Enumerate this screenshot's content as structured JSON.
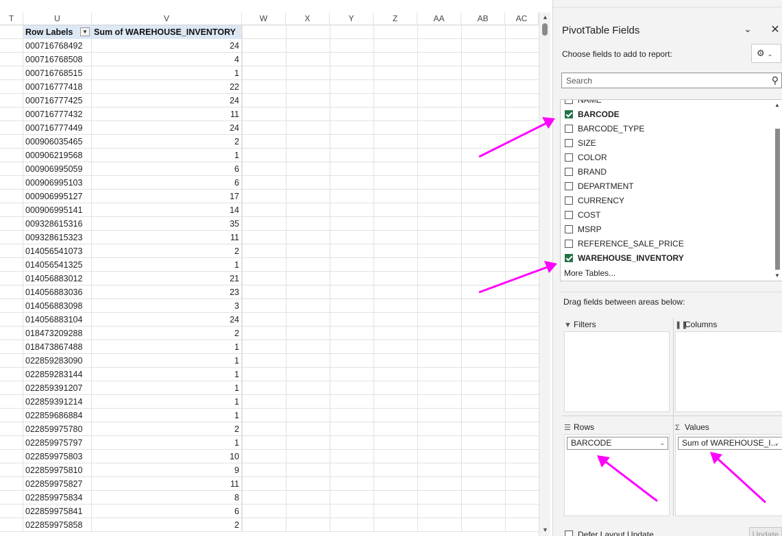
{
  "sheet": {
    "columns": [
      "T",
      "U",
      "V",
      "W",
      "X",
      "Y",
      "Z",
      "AA",
      "AB",
      "AC"
    ],
    "pivot_header": {
      "row_labels": "Row Labels",
      "sum_header": "Sum of WAREHOUSE_INVENTORY"
    },
    "rows": [
      {
        "barcode": "000716768492",
        "qty": "24"
      },
      {
        "barcode": "000716768508",
        "qty": "4"
      },
      {
        "barcode": "000716768515",
        "qty": "1"
      },
      {
        "barcode": "000716777418",
        "qty": "22"
      },
      {
        "barcode": "000716777425",
        "qty": "24"
      },
      {
        "barcode": "000716777432",
        "qty": "11"
      },
      {
        "barcode": "000716777449",
        "qty": "24"
      },
      {
        "barcode": "000906035465",
        "qty": "2"
      },
      {
        "barcode": "000906219568",
        "qty": "1"
      },
      {
        "barcode": "000906995059",
        "qty": "6"
      },
      {
        "barcode": "000906995103",
        "qty": "6"
      },
      {
        "barcode": "000906995127",
        "qty": "17"
      },
      {
        "barcode": "000906995141",
        "qty": "14"
      },
      {
        "barcode": "009328615316",
        "qty": "35"
      },
      {
        "barcode": "009328615323",
        "qty": "11"
      },
      {
        "barcode": "014056541073",
        "qty": "2"
      },
      {
        "barcode": "014056541325",
        "qty": "1"
      },
      {
        "barcode": "014056883012",
        "qty": "21"
      },
      {
        "barcode": "014056883036",
        "qty": "23"
      },
      {
        "barcode": "014056883098",
        "qty": "3"
      },
      {
        "barcode": "014056883104",
        "qty": "24"
      },
      {
        "barcode": "018473209288",
        "qty": "2"
      },
      {
        "barcode": "018473867488",
        "qty": "1"
      },
      {
        "barcode": "022859283090",
        "qty": "1"
      },
      {
        "barcode": "022859283144",
        "qty": "1"
      },
      {
        "barcode": "022859391207",
        "qty": "1"
      },
      {
        "barcode": "022859391214",
        "qty": "1"
      },
      {
        "barcode": "022859686884",
        "qty": "1"
      },
      {
        "barcode": "022859975780",
        "qty": "2"
      },
      {
        "barcode": "022859975797",
        "qty": "1"
      },
      {
        "barcode": "022859975803",
        "qty": "10"
      },
      {
        "barcode": "022859975810",
        "qty": "9"
      },
      {
        "barcode": "022859975827",
        "qty": "11"
      },
      {
        "barcode": "022859975834",
        "qty": "8"
      },
      {
        "barcode": "022859975841",
        "qty": "6"
      },
      {
        "barcode": "022859975858",
        "qty": "2"
      }
    ]
  },
  "pane": {
    "title": "PivotTable Fields",
    "choose_label": "Choose fields to add to report:",
    "search_placeholder": "Search",
    "fields": [
      {
        "name": "NAME",
        "checked": false
      },
      {
        "name": "BARCODE",
        "checked": true
      },
      {
        "name": "BARCODE_TYPE",
        "checked": false
      },
      {
        "name": "SIZE",
        "checked": false
      },
      {
        "name": "COLOR",
        "checked": false
      },
      {
        "name": "BRAND",
        "checked": false
      },
      {
        "name": "DEPARTMENT",
        "checked": false
      },
      {
        "name": "CURRENCY",
        "checked": false
      },
      {
        "name": "COST",
        "checked": false
      },
      {
        "name": "MSRP",
        "checked": false
      },
      {
        "name": "REFERENCE_SALE_PRICE",
        "checked": false
      },
      {
        "name": "WAREHOUSE_INVENTORY",
        "checked": true
      }
    ],
    "more_tables": "More Tables...",
    "drag_label": "Drag fields between areas below:",
    "areas": {
      "filters": "Filters",
      "columns": "Columns",
      "rows": "Rows",
      "values": "Values",
      "rows_pill": "BARCODE",
      "values_pill": "Sum of WAREHOUSE_I..."
    },
    "defer_label": "Defer Layout Update",
    "update_label": "Update"
  },
  "colors": {
    "accent": "#217346",
    "annotation_arrow": "#ff00ff",
    "pivot_header_bg": "#dde8f5"
  },
  "icons": [
    "chevron-down-icon",
    "close-icon",
    "gear-icon",
    "search-icon",
    "filter-icon",
    "columns-icon",
    "rows-icon",
    "sigma-icon"
  ]
}
